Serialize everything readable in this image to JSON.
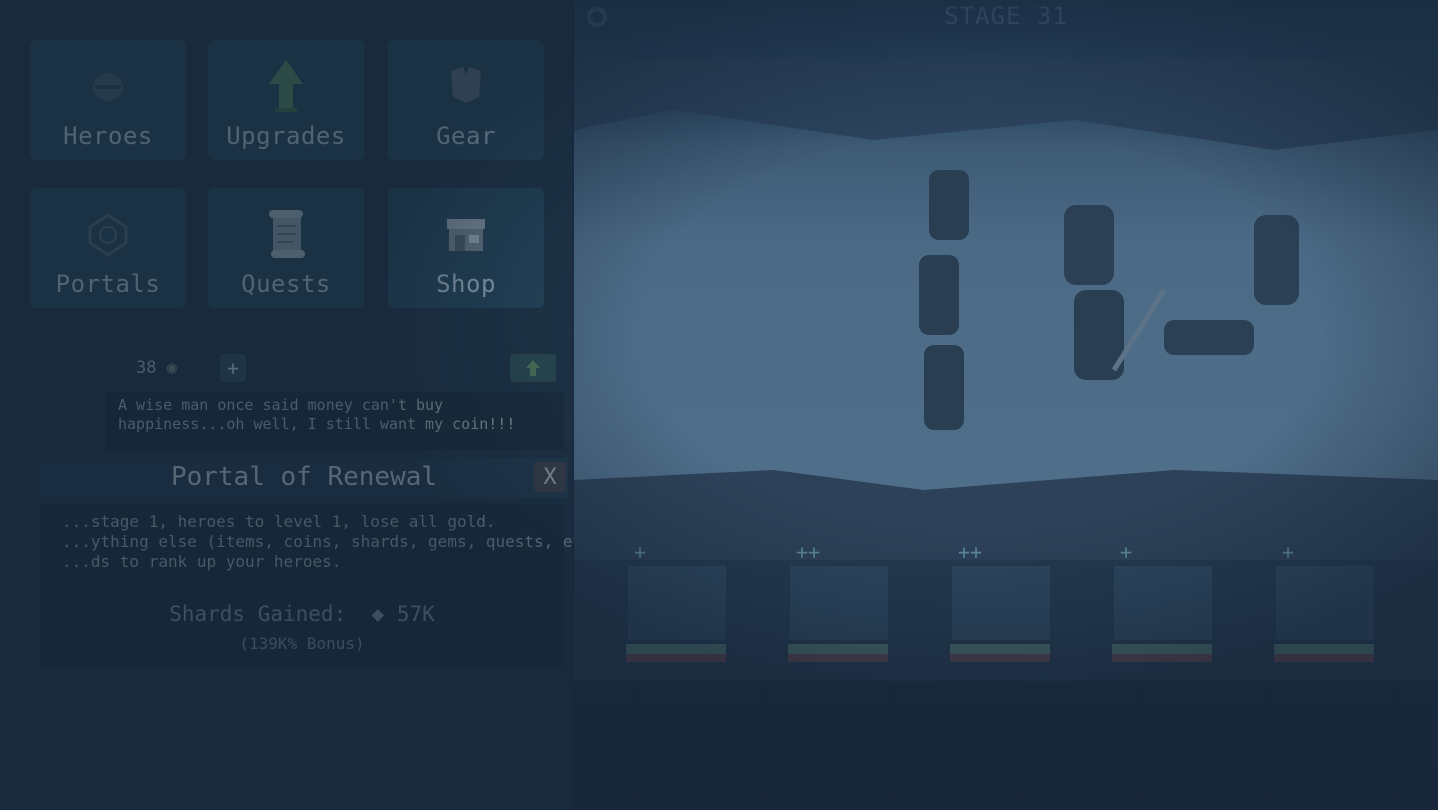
{
  "menu": {
    "heroes": "Heroes",
    "upgrades": "Upgrades",
    "gear": "Gear",
    "portals": "Portals",
    "quests": "Quests",
    "shop": "Shop"
  },
  "currency": {
    "coins": "38"
  },
  "quote": "A wise man once said money can't buy happiness...oh well, I still want my coin!!!",
  "portal": {
    "title": "Portal of Renewal",
    "close": "X",
    "desc_line1": "...stage 1, heroes to level 1, lose all gold.",
    "desc_line2": "...ything else (items, coins, shards, gems, quests, etc.)",
    "desc_line3": "...ds to rank up your heroes.",
    "shards_label": "Shards Gained:",
    "shards_value": "57K",
    "bonus": "(139K% Bonus)"
  },
  "stage": {
    "label": "STAGE 31"
  },
  "heroes": [
    {
      "plus": "+"
    },
    {
      "plus": "++"
    },
    {
      "plus": "++"
    },
    {
      "plus": "+"
    },
    {
      "plus": "+"
    }
  ],
  "colors": {
    "overlay": "#1c2d42",
    "panel": "#1e3346",
    "button": "#24455a"
  }
}
